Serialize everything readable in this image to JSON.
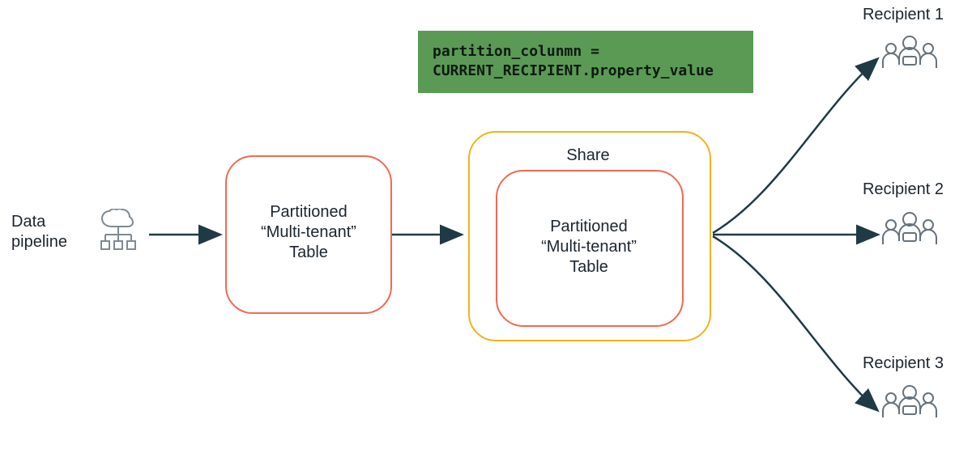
{
  "banner": {
    "code": "partition_colunmn =\nCURRENT_RECIPIENT.property_value"
  },
  "labels": {
    "data_pipeline": "Data\npipeline",
    "share": "Share",
    "table_left": "Partitioned\n“Multi-tenant”\nTable",
    "table_right": "Partitioned\n“Multi-tenant”\nTable",
    "recipient_1": "Recipient 1",
    "recipient_2": "Recipient 2",
    "recipient_3": "Recipient 3"
  }
}
